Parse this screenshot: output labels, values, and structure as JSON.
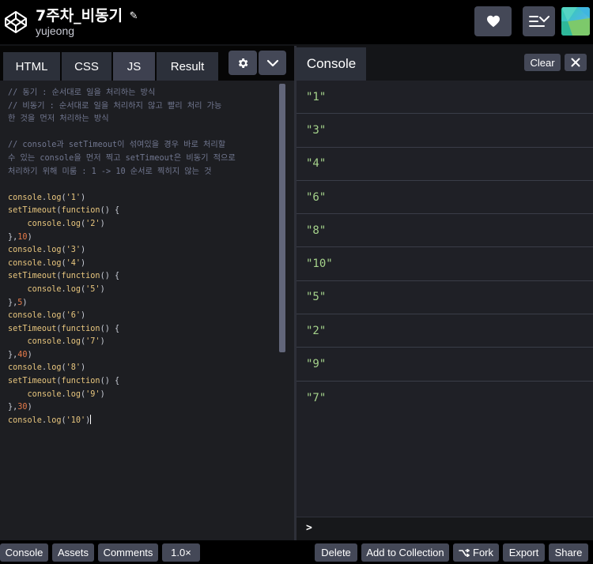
{
  "header": {
    "title": "7주차_비동기",
    "author": "yujeong"
  },
  "editor": {
    "tabs": [
      "HTML",
      "CSS",
      "JS",
      "Result"
    ],
    "active_tab": "JS",
    "code_lines": [
      [
        {
          "t": "cm",
          "v": "// 동기 : 순서대로 일을 처리하는 방식"
        }
      ],
      [
        {
          "t": "cm",
          "v": "// 비동기 : 순서대로 일을 처리하지 않고 빨리 처리 가능"
        }
      ],
      [
        {
          "t": "cm",
          "v": "한 것을 먼저 처리하는 방식"
        }
      ],
      [],
      [
        {
          "t": "cm",
          "v": "// console과 setTimeout이 섞여있을 경우 바로 처리할"
        }
      ],
      [
        {
          "t": "cm",
          "v": "수 있는 console을 먼저 찍고 setTimeout은 비동기 적으로"
        }
      ],
      [
        {
          "t": "cm",
          "v": "처리하기 위해 미룸 : 1 -> 10 순서로 찍히지 않는 것"
        }
      ],
      [],
      [
        {
          "t": "fn",
          "v": "console"
        },
        {
          "t": "pl",
          "v": "."
        },
        {
          "t": "fn",
          "v": "log"
        },
        {
          "t": "pl",
          "v": "("
        },
        {
          "t": "str",
          "v": "'1'"
        },
        {
          "t": "pl",
          "v": ")"
        }
      ],
      [
        {
          "t": "fn",
          "v": "setTimeout"
        },
        {
          "t": "pl",
          "v": "("
        },
        {
          "t": "fn",
          "v": "function"
        },
        {
          "t": "pl",
          "v": "() {"
        }
      ],
      [
        {
          "t": "pl",
          "v": "    "
        },
        {
          "t": "fn",
          "v": "console"
        },
        {
          "t": "pl",
          "v": "."
        },
        {
          "t": "fn",
          "v": "log"
        },
        {
          "t": "pl",
          "v": "("
        },
        {
          "t": "str",
          "v": "'2'"
        },
        {
          "t": "pl",
          "v": ")"
        }
      ],
      [
        {
          "t": "pl",
          "v": "},"
        },
        {
          "t": "num",
          "v": "10"
        },
        {
          "t": "pl",
          "v": ")"
        }
      ],
      [
        {
          "t": "fn",
          "v": "console"
        },
        {
          "t": "pl",
          "v": "."
        },
        {
          "t": "fn",
          "v": "log"
        },
        {
          "t": "pl",
          "v": "("
        },
        {
          "t": "str",
          "v": "'3'"
        },
        {
          "t": "pl",
          "v": ")"
        }
      ],
      [
        {
          "t": "fn",
          "v": "console"
        },
        {
          "t": "pl",
          "v": "."
        },
        {
          "t": "fn",
          "v": "log"
        },
        {
          "t": "pl",
          "v": "("
        },
        {
          "t": "str",
          "v": "'4'"
        },
        {
          "t": "pl",
          "v": ")"
        }
      ],
      [
        {
          "t": "fn",
          "v": "setTimeout"
        },
        {
          "t": "pl",
          "v": "("
        },
        {
          "t": "fn",
          "v": "function"
        },
        {
          "t": "pl",
          "v": "() {"
        }
      ],
      [
        {
          "t": "pl",
          "v": "    "
        },
        {
          "t": "fn",
          "v": "console"
        },
        {
          "t": "pl",
          "v": "."
        },
        {
          "t": "fn",
          "v": "log"
        },
        {
          "t": "pl",
          "v": "("
        },
        {
          "t": "str",
          "v": "'5'"
        },
        {
          "t": "pl",
          "v": ")"
        }
      ],
      [
        {
          "t": "pl",
          "v": "},"
        },
        {
          "t": "num",
          "v": "5"
        },
        {
          "t": "pl",
          "v": ")"
        }
      ],
      [
        {
          "t": "fn",
          "v": "console"
        },
        {
          "t": "pl",
          "v": "."
        },
        {
          "t": "fn",
          "v": "log"
        },
        {
          "t": "pl",
          "v": "("
        },
        {
          "t": "str",
          "v": "'6'"
        },
        {
          "t": "pl",
          "v": ")"
        }
      ],
      [
        {
          "t": "fn",
          "v": "setTimeout"
        },
        {
          "t": "pl",
          "v": "("
        },
        {
          "t": "fn",
          "v": "function"
        },
        {
          "t": "pl",
          "v": "() {"
        }
      ],
      [
        {
          "t": "pl",
          "v": "    "
        },
        {
          "t": "fn",
          "v": "console"
        },
        {
          "t": "pl",
          "v": "."
        },
        {
          "t": "fn",
          "v": "log"
        },
        {
          "t": "pl",
          "v": "("
        },
        {
          "t": "str",
          "v": "'7'"
        },
        {
          "t": "pl",
          "v": ")"
        }
      ],
      [
        {
          "t": "pl",
          "v": "},"
        },
        {
          "t": "num",
          "v": "40"
        },
        {
          "t": "pl",
          "v": ")"
        }
      ],
      [
        {
          "t": "fn",
          "v": "console"
        },
        {
          "t": "pl",
          "v": "."
        },
        {
          "t": "fn",
          "v": "log"
        },
        {
          "t": "pl",
          "v": "("
        },
        {
          "t": "str",
          "v": "'8'"
        },
        {
          "t": "pl",
          "v": ")"
        }
      ],
      [
        {
          "t": "fn",
          "v": "setTimeout"
        },
        {
          "t": "pl",
          "v": "("
        },
        {
          "t": "fn",
          "v": "function"
        },
        {
          "t": "pl",
          "v": "() {"
        }
      ],
      [
        {
          "t": "pl",
          "v": "    "
        },
        {
          "t": "fn",
          "v": "console"
        },
        {
          "t": "pl",
          "v": "."
        },
        {
          "t": "fn",
          "v": "log"
        },
        {
          "t": "pl",
          "v": "("
        },
        {
          "t": "str",
          "v": "'9'"
        },
        {
          "t": "pl",
          "v": ")"
        }
      ],
      [
        {
          "t": "pl",
          "v": "},"
        },
        {
          "t": "num",
          "v": "30"
        },
        {
          "t": "pl",
          "v": ")"
        }
      ],
      [
        {
          "t": "fn",
          "v": "console"
        },
        {
          "t": "pl",
          "v": "."
        },
        {
          "t": "fn",
          "v": "log"
        },
        {
          "t": "pl",
          "v": "("
        },
        {
          "t": "str",
          "v": "'10'"
        },
        {
          "t": "pl",
          "v": ")"
        },
        {
          "t": "caret",
          "v": ""
        }
      ]
    ]
  },
  "console": {
    "title": "Console",
    "clear_label": "Clear",
    "outputs": [
      "\"1\"",
      "\"3\"",
      "\"4\"",
      "\"6\"",
      "\"8\"",
      "\"10\"",
      "\"5\"",
      "\"2\"",
      "\"9\"",
      "\"7\""
    ],
    "prompt": ">"
  },
  "footer": {
    "left": [
      "Console",
      "Assets",
      "Comments",
      "1.0×"
    ],
    "right": [
      "Delete",
      "Add to Collection",
      "Fork",
      "Export",
      "Share"
    ]
  },
  "colors": {
    "background": "#131417",
    "editor_bg": "#1d1e22",
    "button_bg": "#444857",
    "comment": "#717790",
    "function": "#e8c67e",
    "number": "#e67b4a",
    "console_string": "#a5d28b"
  },
  "icons": [
    "codepen-logo-icon",
    "pencil-icon",
    "heart-icon",
    "layout-icon",
    "settings-icon",
    "chevron-down-icon",
    "close-icon",
    "fork-icon"
  ]
}
